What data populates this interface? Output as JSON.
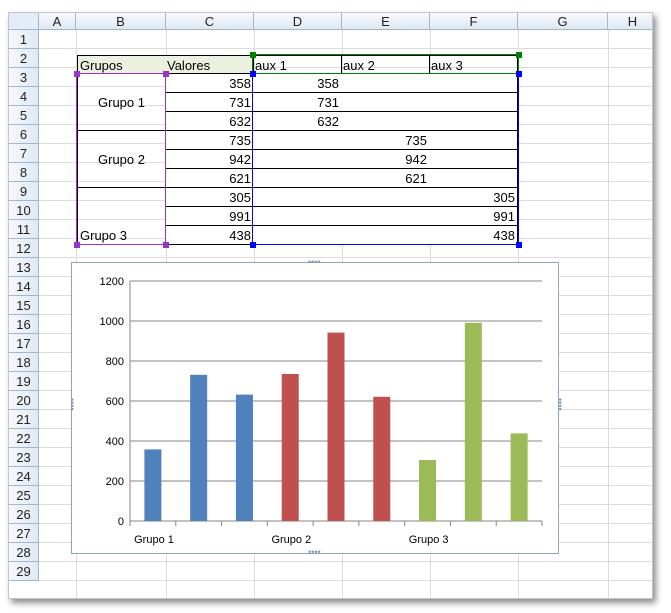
{
  "columns": [
    "A",
    "B",
    "C",
    "D",
    "E",
    "F",
    "G",
    "H"
  ],
  "rows": [
    "1",
    "2",
    "3",
    "4",
    "5",
    "6",
    "7",
    "8",
    "9",
    "10",
    "11",
    "12",
    "13",
    "14",
    "15",
    "16",
    "17",
    "18",
    "19",
    "20",
    "21",
    "22",
    "23",
    "24",
    "25",
    "26",
    "27",
    "28",
    "29"
  ],
  "table": {
    "headers": [
      "Grupos",
      "Valores",
      "aux 1",
      "aux 2",
      "aux 3"
    ],
    "groups": [
      "Grupo 1",
      "Grupo 2",
      "Grupo 3"
    ],
    "valores": [
      "358",
      "731",
      "632",
      "735",
      "942",
      "621",
      "305",
      "991",
      "438"
    ],
    "aux1": [
      "358",
      "731",
      "632",
      "",
      "",
      "",
      "",
      "",
      ""
    ],
    "aux2": [
      "",
      "",
      "",
      "735",
      "942",
      "621",
      "",
      "",
      ""
    ],
    "aux3": [
      "",
      "",
      "",
      "",
      "",
      "",
      "305",
      "991",
      "438"
    ]
  },
  "colors": {
    "header_fill": "#ebf1de",
    "grupo1": "#4f81bd",
    "grupo2": "#c0504d",
    "grupo3": "#9bbb59",
    "range_purple": "#9933cc",
    "range_blue": "#0000ff",
    "range_green": "#008000"
  },
  "chart_data": {
    "type": "bar",
    "categories": [
      "Grupo 1",
      "",
      "",
      "Grupo 2",
      "",
      "",
      "Grupo 3",
      "",
      ""
    ],
    "series": [
      {
        "values": [
          358,
          731,
          632,
          null,
          null,
          null,
          null,
          null,
          null
        ],
        "color": "#4f81bd"
      },
      {
        "values": [
          null,
          null,
          null,
          735,
          942,
          621,
          null,
          null,
          null
        ],
        "color": "#c0504d"
      },
      {
        "values": [
          null,
          null,
          null,
          null,
          null,
          null,
          305,
          991,
          438
        ],
        "color": "#9bbb59"
      }
    ],
    "yticks": [
      "0",
      "200",
      "400",
      "600",
      "800",
      "1000",
      "1200"
    ],
    "ylim": [
      0,
      1200
    ],
    "grid": true,
    "legend": "none"
  }
}
